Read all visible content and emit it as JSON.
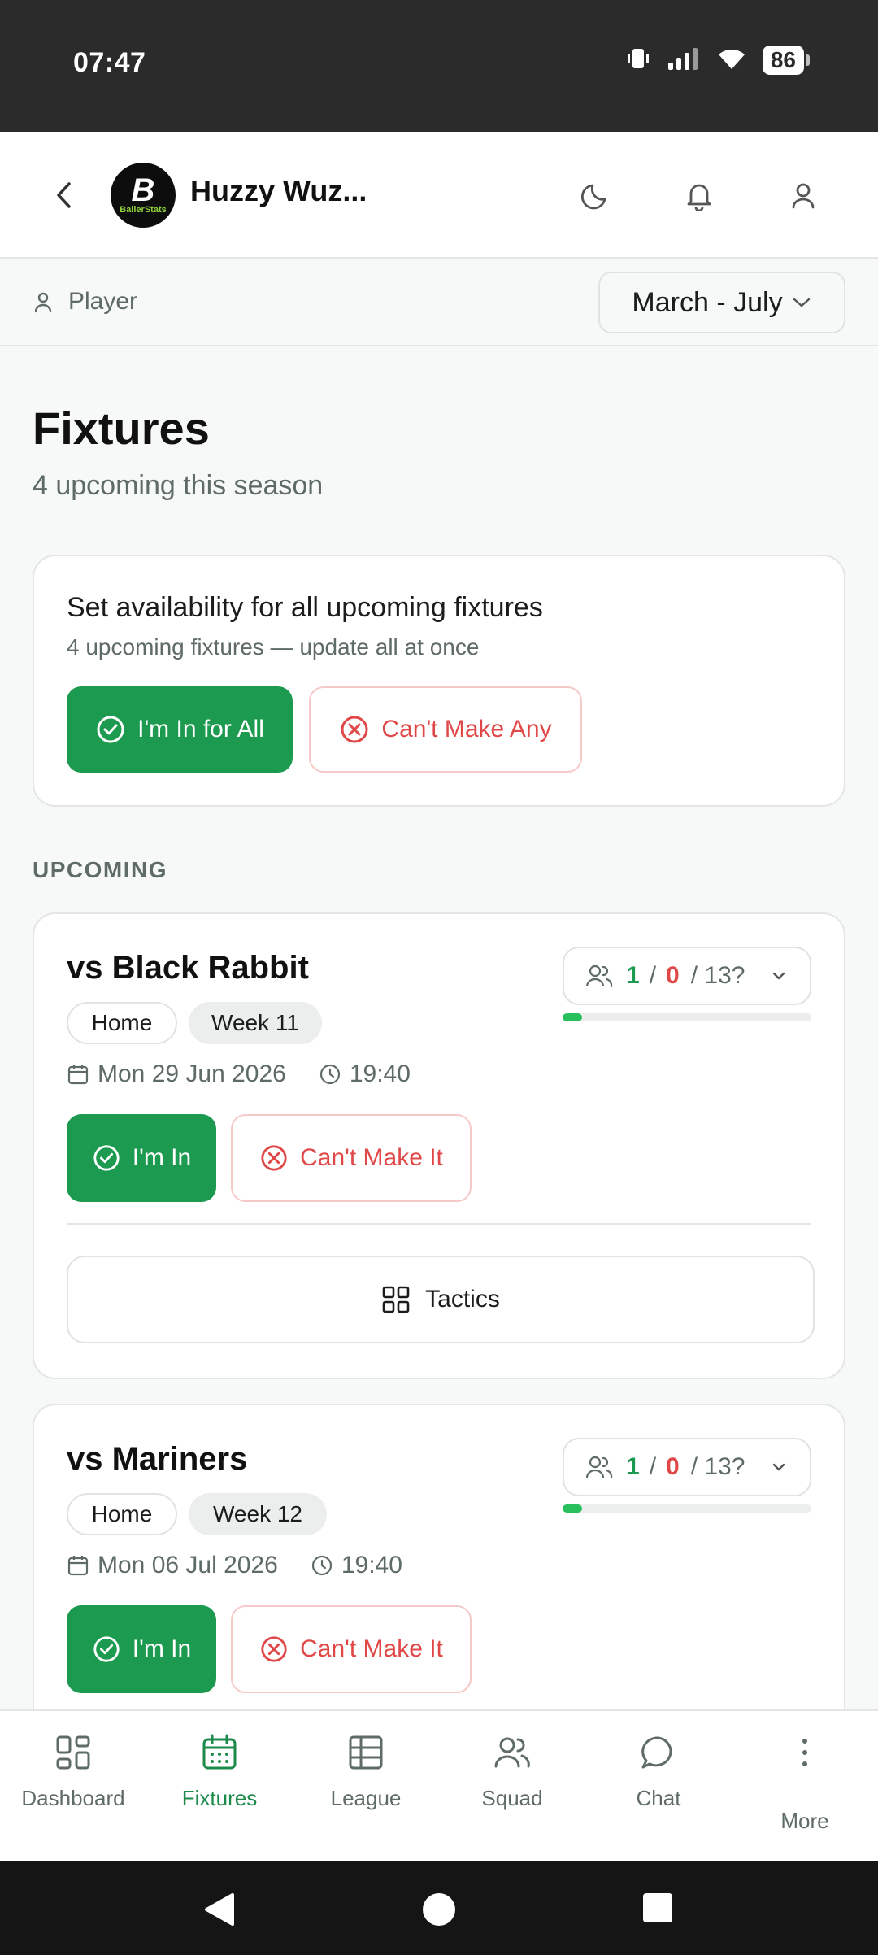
{
  "status_bar": {
    "time": "07:47",
    "battery": "86"
  },
  "header": {
    "team_name": "Huzzy Wuz...",
    "logo_letter": "B",
    "logo_text": "BallerStats"
  },
  "role_bar": {
    "role": "Player",
    "season": "March - July"
  },
  "page": {
    "title": "Fixtures",
    "subtitle": "4 upcoming this season"
  },
  "bulk_availability": {
    "title": "Set availability for all upcoming fixtures",
    "description": "4 upcoming fixtures — update all at once",
    "in_all_label": "I'm In for All",
    "cant_any_label": "Can't Make Any"
  },
  "section_label": "UPCOMING",
  "fixtures": [
    {
      "opponent": "vs Black Rabbit",
      "venue": "Home",
      "week": "Week 11",
      "date": "Mon 29 Jun 2026",
      "time": "19:40",
      "available": "1",
      "unavailable": "0",
      "total": "/ 13?",
      "progress": 0.077,
      "in_label": "I'm In",
      "out_label": "Can't Make It",
      "tactics_label": "Tactics"
    },
    {
      "opponent": "vs Mariners",
      "venue": "Home",
      "week": "Week 12",
      "date": "Mon 06 Jul 2026",
      "time": "19:40",
      "available": "1",
      "unavailable": "0",
      "total": "/ 13?",
      "progress": 0.077,
      "in_label": "I'm In",
      "out_label": "Can't Make It"
    }
  ],
  "bottom_nav": [
    {
      "label": "Dashboard",
      "icon": "dashboard-icon"
    },
    {
      "label": "Fixtures",
      "icon": "calendar-icon",
      "active": true
    },
    {
      "label": "League",
      "icon": "table-icon"
    },
    {
      "label": "Squad",
      "icon": "users-icon"
    },
    {
      "label": "Chat",
      "icon": "chat-icon"
    },
    {
      "label": "More",
      "icon": "more-vertical-icon"
    }
  ],
  "colors": {
    "accent": "#1c9a4f",
    "danger": "#e04848",
    "progress": "#28c05d"
  }
}
